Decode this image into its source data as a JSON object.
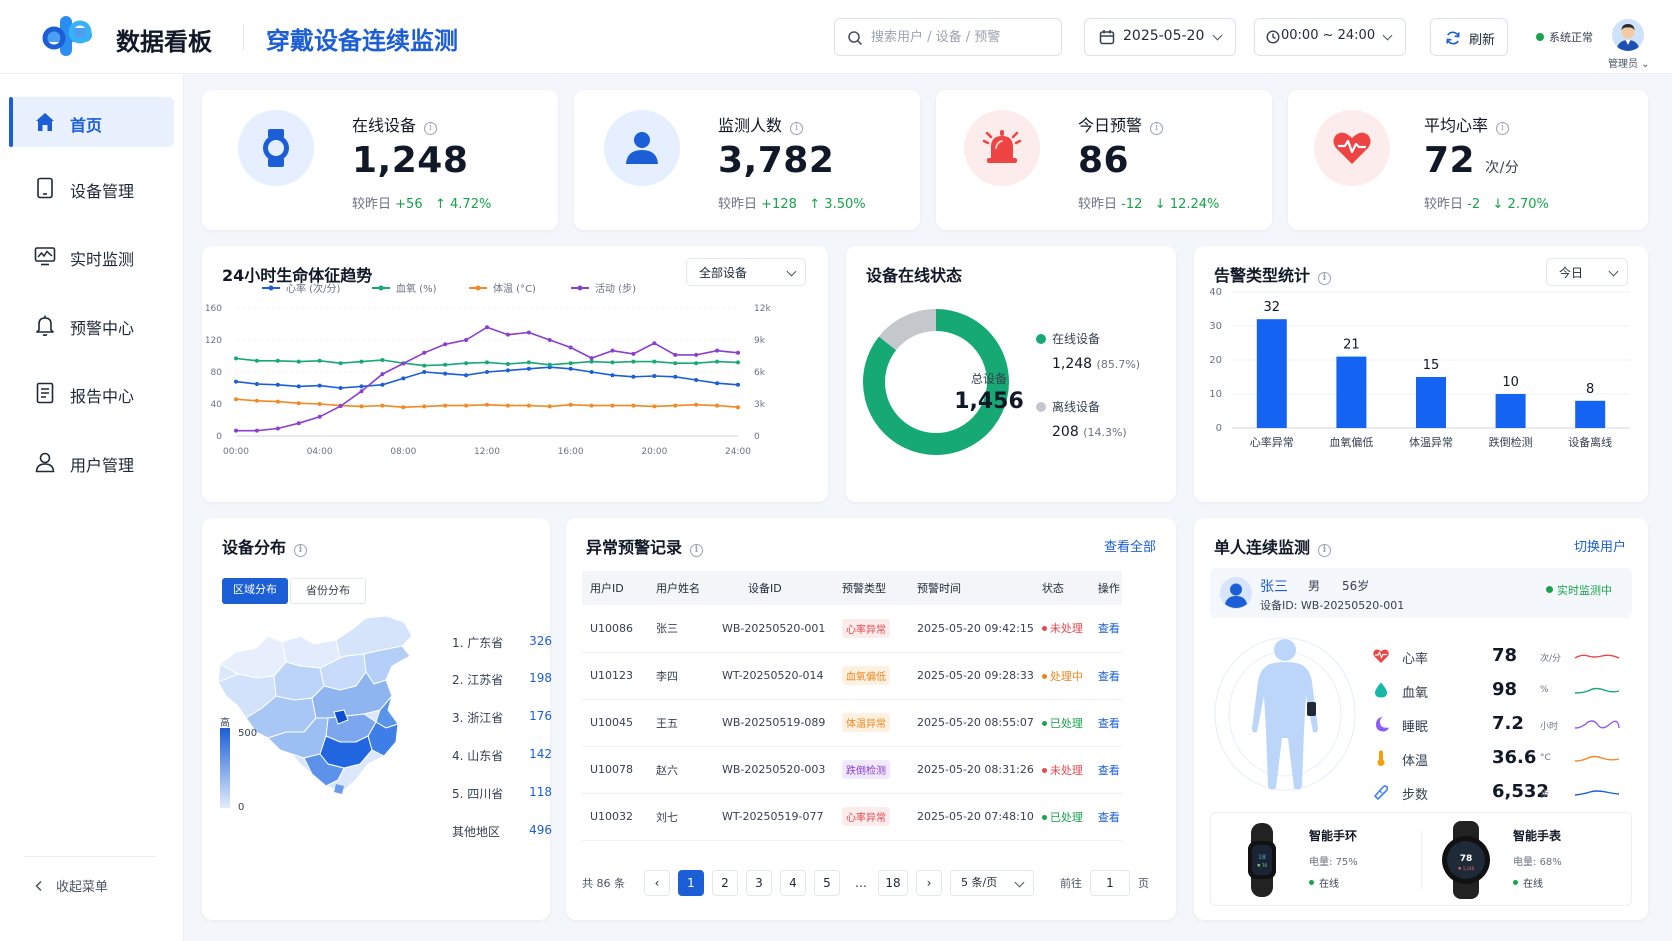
{
  "header": {
    "app_title": "数据看板",
    "page_title": "穿戴设备连续监测",
    "search_placeholder": "搜索用户 / 设备 / 预警",
    "date": "2025-05-20",
    "time_range": "00:00 ~ 24:00",
    "refresh_label": "刷新",
    "system_status": "系统正常",
    "user_label": "管理员"
  },
  "sidebar": {
    "items": [
      {
        "label": "首页",
        "icon": "home-icon",
        "active": true
      },
      {
        "label": "设备管理",
        "icon": "device-icon"
      },
      {
        "label": "实时监测",
        "icon": "monitor-icon"
      },
      {
        "label": "预警中心",
        "icon": "bell-icon"
      },
      {
        "label": "报告中心",
        "icon": "report-icon"
      },
      {
        "label": "用户管理",
        "icon": "user-icon"
      }
    ],
    "collapse_label": "收起菜单"
  },
  "kpis": [
    {
      "title": "在线设备",
      "value": "1,248",
      "unit": "",
      "cmp_label": "较昨日",
      "delta": "+56",
      "pct": "↑ 4.72%",
      "icon": "watch-icon",
      "color": "#1b5ed6"
    },
    {
      "title": "监测人数",
      "value": "3,782",
      "unit": "",
      "cmp_label": "较昨日",
      "delta": "+128",
      "pct": "↑ 3.50%",
      "icon": "person-icon",
      "color": "#1b5ed6"
    },
    {
      "title": "今日预警",
      "value": "86",
      "unit": "",
      "cmp_label": "较昨日",
      "delta": "-12",
      "pct": "↓ 12.24%",
      "icon": "alarm-bell-icon",
      "color": "#ef4444"
    },
    {
      "title": "平均心率",
      "value": "72",
      "unit": "次/分",
      "cmp_label": "较昨日",
      "delta": "-2",
      "pct": "↓ 2.70%",
      "icon": "heart-icon",
      "color": "#ef4444"
    }
  ],
  "trend": {
    "title": "24小时生命体征趋势",
    "filter": "全部设备"
  },
  "online_status": {
    "title": "设备在线状态",
    "total_label": "总设备",
    "total": "1,456",
    "online_label": "在线设备",
    "online_value": "1,248",
    "online_pct": "(85.7%)",
    "offline_label": "离线设备",
    "offline_value": "208",
    "offline_pct": "(14.3%)",
    "online_color": "#16a974",
    "offline_color": "#c4c7cc"
  },
  "alert_stats": {
    "title": "告警类型统计",
    "filter": "今日"
  },
  "distribution": {
    "title": "设备分布",
    "tabs": [
      "区域分布",
      "省份分布"
    ],
    "legend_high": "高",
    "legend_max": "500",
    "legend_min": "0",
    "ranks": [
      {
        "name": "1. 广东省",
        "value": "326"
      },
      {
        "name": "2. 江苏省",
        "value": "198"
      },
      {
        "name": "3. 浙江省",
        "value": "176"
      },
      {
        "name": "4. 山东省",
        "value": "142"
      },
      {
        "name": "5. 四川省",
        "value": "118"
      },
      {
        "name": "其他地区",
        "value": "496"
      }
    ]
  },
  "alerts_table": {
    "title": "异常预警记录",
    "view_all": "查看全部",
    "columns": [
      "用户ID",
      "用户姓名",
      "设备ID",
      "预警类型",
      "预警时间",
      "状态",
      "操作"
    ],
    "rows": [
      {
        "uid": "U10086",
        "name": "张三",
        "device": "WB-20250520-001",
        "type": "心率异常",
        "type_color": "red",
        "time": "2025-05-20 09:42:15",
        "status": "未处理",
        "status_color": "red",
        "action": "查看"
      },
      {
        "uid": "U10123",
        "name": "李四",
        "device": "WT-20250520-014",
        "type": "血氧偏低",
        "type_color": "orange",
        "time": "2025-05-20 09:28:33",
        "status": "处理中",
        "status_color": "orange",
        "action": "查看"
      },
      {
        "uid": "U10045",
        "name": "王五",
        "device": "WB-20250519-089",
        "type": "体温异常",
        "type_color": "orange",
        "time": "2025-05-20 08:55:07",
        "status": "已处理",
        "status_color": "green",
        "action": "查看"
      },
      {
        "uid": "U10078",
        "name": "赵六",
        "device": "WB-20250520-003",
        "type": "跌倒检测",
        "type_color": "purple",
        "time": "2025-05-20 08:31:26",
        "status": "未处理",
        "status_color": "red",
        "action": "查看"
      },
      {
        "uid": "U10032",
        "name": "刘七",
        "device": "WT-20250519-077",
        "type": "心率异常",
        "type_color": "red",
        "time": "2025-05-20 07:48:10",
        "status": "已处理",
        "status_color": "green",
        "action": "查看"
      }
    ],
    "pagination": {
      "total_text": "共 86 条",
      "pages": [
        "1",
        "2",
        "3",
        "4",
        "5",
        "…",
        "18"
      ],
      "current": "1",
      "page_size": "5 条/页",
      "goto_label": "前往",
      "goto_value": "1",
      "page_suffix": "页"
    }
  },
  "single_monitor": {
    "title": "单人连续监测",
    "switch_label": "切换用户",
    "user_name": "张三",
    "gender": "男",
    "age": "56岁",
    "device_label": "设备ID:",
    "device_id": "WB-20250520-001",
    "live_label": "实时监测中",
    "metrics": [
      {
        "label": "心率",
        "value": "78",
        "unit": "次/分",
        "icon": "heart-icon",
        "color": "#ef4444"
      },
      {
        "label": "血氧",
        "value": "98",
        "unit": "%",
        "icon": "drop-icon",
        "color": "#14b8a6"
      },
      {
        "label": "睡眠",
        "value": "7.2",
        "unit": "小时",
        "icon": "moon-icon",
        "color": "#8b5cf6"
      },
      {
        "label": "体温",
        "value": "36.6",
        "unit": "°C",
        "icon": "thermometer-icon",
        "color": "#f59e0b"
      },
      {
        "label": "步数",
        "value": "6,532",
        "unit": "步",
        "icon": "shoe-icon",
        "color": "#3b82f6"
      }
    ],
    "devices": [
      {
        "name": "智能手环",
        "battery_label": "电量:",
        "battery": "75%",
        "status": "在线"
      },
      {
        "name": "智能手表",
        "battery_label": "电量:",
        "battery": "68%",
        "status": "在线"
      }
    ]
  },
  "chart_data": [
    {
      "type": "line",
      "title": "24小时生命体征趋势",
      "x": [
        "00:00",
        "01:00",
        "02:00",
        "03:00",
        "04:00",
        "05:00",
        "06:00",
        "07:00",
        "08:00",
        "09:00",
        "10:00",
        "11:00",
        "12:00",
        "13:00",
        "14:00",
        "15:00",
        "16:00",
        "17:00",
        "18:00",
        "19:00",
        "20:00",
        "21:00",
        "22:00",
        "23:00",
        "24:00"
      ],
      "xticks": [
        "00:00",
        "04:00",
        "08:00",
        "12:00",
        "16:00",
        "20:00",
        "24:00"
      ],
      "ylim": [
        0,
        160
      ],
      "yticks": [
        "0",
        "40",
        "80",
        "120",
        "160"
      ],
      "y2lim": [
        0,
        12000
      ],
      "y2ticks": [
        "0",
        "3k",
        "6k",
        "9k",
        "12k"
      ],
      "series": [
        {
          "name": "心率 (次/分)",
          "color": "#1b5ed6",
          "axis": "left",
          "values": [
            68,
            65,
            64,
            62,
            63,
            60,
            62,
            64,
            72,
            80,
            78,
            76,
            80,
            82,
            84,
            86,
            84,
            80,
            76,
            74,
            75,
            74,
            70,
            66,
            64
          ]
        },
        {
          "name": "血氧 (%)",
          "color": "#16a974",
          "axis": "left",
          "values": [
            97,
            94,
            94,
            93,
            94,
            91,
            93,
            95,
            91,
            88,
            89,
            91,
            92,
            90,
            92,
            89,
            91,
            93,
            92,
            93,
            93,
            91,
            91,
            93,
            92
          ]
        },
        {
          "name": "体温 (°C)",
          "color": "#f08a24",
          "axis": "left",
          "values": [
            46,
            44,
            43,
            41,
            40,
            38,
            37,
            38,
            36,
            37,
            38,
            38,
            39,
            38,
            38,
            37,
            39,
            38,
            38,
            38,
            37,
            38,
            39,
            38,
            36
          ]
        },
        {
          "name": "活动 (步)",
          "color": "#8b3fd1",
          "axis": "right",
          "values": [
            500,
            500,
            700,
            1200,
            1800,
            2800,
            4200,
            5800,
            6800,
            7800,
            8600,
            9000,
            10200,
            9500,
            9700,
            9000,
            8300,
            7300,
            8000,
            7700,
            8700,
            7600,
            7600,
            8000,
            7800
          ]
        }
      ]
    },
    {
      "type": "pie",
      "title": "设备在线状态",
      "labels": [
        "在线设备",
        "离线设备"
      ],
      "values": [
        1248,
        208
      ]
    },
    {
      "type": "bar",
      "title": "告警类型统计",
      "categories": [
        "心率异常",
        "血氧偏低",
        "体温异常",
        "跌倒检测",
        "设备离线"
      ],
      "values": [
        32,
        21,
        15,
        10,
        8
      ],
      "ylim": [
        0,
        40
      ],
      "yticks": [
        "0",
        "10",
        "20",
        "30",
        "40"
      ],
      "color": "#1463f3"
    }
  ]
}
